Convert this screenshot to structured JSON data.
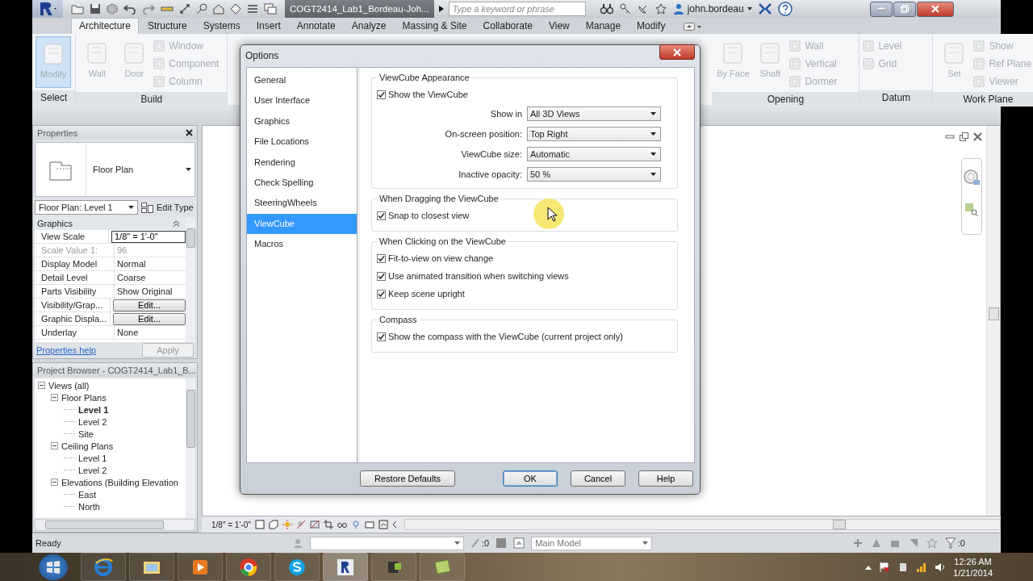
{
  "title_bar": {
    "file_title": "COGT2414_Lab1_Bordeau-Joh...",
    "search": {
      "placeholder": "Type a keyword or phrase"
    },
    "user": "john.bordeau"
  },
  "ribbon_tabs": [
    {
      "label": "Architecture",
      "selected": true
    },
    {
      "label": "Structure",
      "selected": false
    },
    {
      "label": "Systems",
      "selected": false
    },
    {
      "label": "Insert",
      "selected": false
    },
    {
      "label": "Annotate",
      "selected": false
    },
    {
      "label": "Analyze",
      "selected": false
    },
    {
      "label": "Massing & Site",
      "selected": false
    },
    {
      "label": "Collaborate",
      "selected": false
    },
    {
      "label": "View",
      "selected": false
    },
    {
      "label": "Manage",
      "selected": false
    },
    {
      "label": "Modify",
      "selected": false
    }
  ],
  "ribbon_panels_left": [
    {
      "title": "Select",
      "tools": [
        {
          "label": "Modify",
          "kind": "large",
          "selected": true
        }
      ]
    },
    {
      "title": "Build",
      "tools": [
        {
          "label": "Wall",
          "kind": "large",
          "selected": false
        },
        {
          "label": "Door",
          "kind": "large",
          "selected": false
        },
        {
          "label": "Window",
          "kind": "small",
          "selected": false
        },
        {
          "label": "Component",
          "kind": "small",
          "selected": false
        },
        {
          "label": "Column",
          "kind": "small",
          "selected": false
        }
      ]
    }
  ],
  "ribbon_panels_right": [
    {
      "title": "Opening",
      "tools": [
        {
          "label": "By Face",
          "kind": "large",
          "selected": false
        },
        {
          "label": "Shaft",
          "kind": "large",
          "selected": false
        },
        {
          "label": "Wall",
          "kind": "small",
          "selected": false
        },
        {
          "label": "Vertical",
          "kind": "small",
          "selected": false
        },
        {
          "label": "Dormer",
          "kind": "small",
          "selected": false
        }
      ]
    },
    {
      "title": "Datum",
      "tools": [
        {
          "label": "Level",
          "kind": "small",
          "selected": false
        },
        {
          "label": "Grid",
          "kind": "small",
          "selected": false
        }
      ]
    },
    {
      "title": "Work Plane",
      "tools": [
        {
          "label": "Set",
          "kind": "large",
          "selected": false
        },
        {
          "label": "Show",
          "kind": "small",
          "selected": false
        },
        {
          "label": "Ref Plane",
          "kind": "small",
          "selected": false
        },
        {
          "label": "Viewer",
          "kind": "small",
          "selected": false
        }
      ]
    }
  ],
  "properties": {
    "title": "Properties",
    "type_name": "Floor Plan",
    "instance": "Floor Plan: Level 1",
    "edit_type": "Edit Type",
    "group": "Graphics",
    "rows": [
      {
        "name": "View Scale",
        "value": "1/8\" = 1'-0\"",
        "kind": "input",
        "disabled": false
      },
      {
        "name": "Scale Value    1:",
        "value": "96",
        "kind": "text",
        "disabled": true
      },
      {
        "name": "Display Model",
        "value": "Normal",
        "kind": "text",
        "disabled": false
      },
      {
        "name": "Detail Level",
        "value": "Coarse",
        "kind": "text",
        "disabled": false
      },
      {
        "name": "Parts Visibility",
        "value": "Show Original",
        "kind": "text",
        "disabled": false
      },
      {
        "name": "Visibility/Grap...",
        "value": "Edit...",
        "kind": "button",
        "disabled": false
      },
      {
        "name": "Graphic Displa...",
        "value": "Edit...",
        "kind": "button",
        "disabled": false
      },
      {
        "name": "Underlay",
        "value": "None",
        "kind": "text",
        "disabled": false
      }
    ],
    "help_link": "Properties help",
    "apply": "Apply"
  },
  "project_browser": {
    "title": "Project Browser - COGT2414_Lab1_B...",
    "tree": [
      {
        "label": "Views (all)",
        "expanded": true,
        "selected": false,
        "children": [
          {
            "label": "Floor Plans",
            "expanded": true,
            "selected": false,
            "children": [
              {
                "label": "Level 1",
                "selected": true
              },
              {
                "label": "Level 2",
                "selected": false
              },
              {
                "label": "Site",
                "selected": false
              }
            ]
          },
          {
            "label": "Ceiling Plans",
            "expanded": true,
            "selected": false,
            "children": [
              {
                "label": "Level 1",
                "selected": false
              },
              {
                "label": "Level 2",
                "selected": false
              }
            ]
          },
          {
            "label": "Elevations (Building Elevation",
            "expanded": true,
            "selected": false,
            "children": [
              {
                "label": "East",
                "selected": false
              },
              {
                "label": "North",
                "selected": false
              }
            ]
          }
        ]
      }
    ]
  },
  "view_control_bar": {
    "scale": "1/8\" = 1'-0\""
  },
  "status_bar": {
    "message": "Ready",
    "selection_count": ":0",
    "model": "Main Model",
    "filter_count": ":0"
  },
  "options_dialog": {
    "title": "Options",
    "categories": [
      {
        "label": "General",
        "selected": false
      },
      {
        "label": "User Interface",
        "selected": false
      },
      {
        "label": "Graphics",
        "selected": false
      },
      {
        "label": "File Locations",
        "selected": false
      },
      {
        "label": "Rendering",
        "selected": false
      },
      {
        "label": "Check Spelling",
        "selected": false
      },
      {
        "label": "SteeringWheels",
        "selected": false
      },
      {
        "label": "ViewCube",
        "selected": true
      },
      {
        "label": "Macros",
        "selected": false
      }
    ],
    "groups": [
      {
        "title": "ViewCube Appearance",
        "checkboxes": [
          {
            "label": "Show the ViewCube",
            "checked": true
          }
        ],
        "fields": [
          {
            "label": "Show in",
            "value": "All 3D Views"
          },
          {
            "label": "On-screen position:",
            "value": "Top Right"
          },
          {
            "label": "ViewCube size:",
            "value": "Automatic"
          },
          {
            "label": "Inactive opacity:",
            "value": "50 %"
          }
        ]
      },
      {
        "title": "When Dragging the ViewCube",
        "checkboxes": [
          {
            "label": "Snap to closest view",
            "checked": true
          }
        ]
      },
      {
        "title": "When Clicking on the ViewCube",
        "checkboxes": [
          {
            "label": "Fit-to-view on view change",
            "checked": true
          },
          {
            "label": "Use animated transition when switching views",
            "checked": true
          },
          {
            "label": "Keep scene upright",
            "checked": true
          }
        ]
      },
      {
        "title": "Compass",
        "checkboxes": [
          {
            "label": "Show the compass with the ViewCube (current project only)",
            "checked": true
          }
        ]
      }
    ],
    "restore_defaults": "Restore Defaults",
    "buttons": [
      "OK",
      "Cancel",
      "Help"
    ]
  },
  "taskbar": {
    "time": "12:26 AM",
    "date": "1/21/2014"
  }
}
